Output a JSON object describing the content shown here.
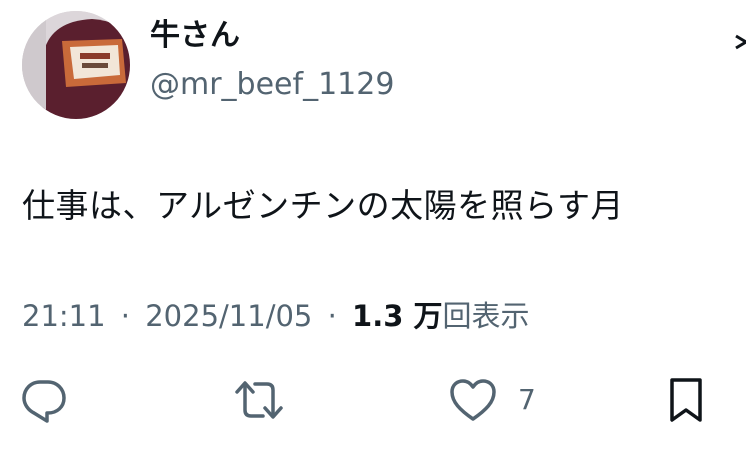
{
  "author": {
    "display_name": "牛さん",
    "handle": "@mr_beef_1129"
  },
  "tweet": {
    "text": "仕事は、アルゼンチンの太陽を照らす月"
  },
  "meta": {
    "time": "21:11",
    "separator": "·",
    "date": "2025/11/05",
    "views_count": "1.3 万",
    "views_label": "回表示"
  },
  "actions": {
    "reply_icon": "reply-icon",
    "retweet_icon": "retweet-icon",
    "like_icon": "heart-icon",
    "like_count": "7",
    "bookmark_icon": "bookmark-icon"
  },
  "colors": {
    "text": "#0f1419",
    "secondary": "#536471"
  }
}
